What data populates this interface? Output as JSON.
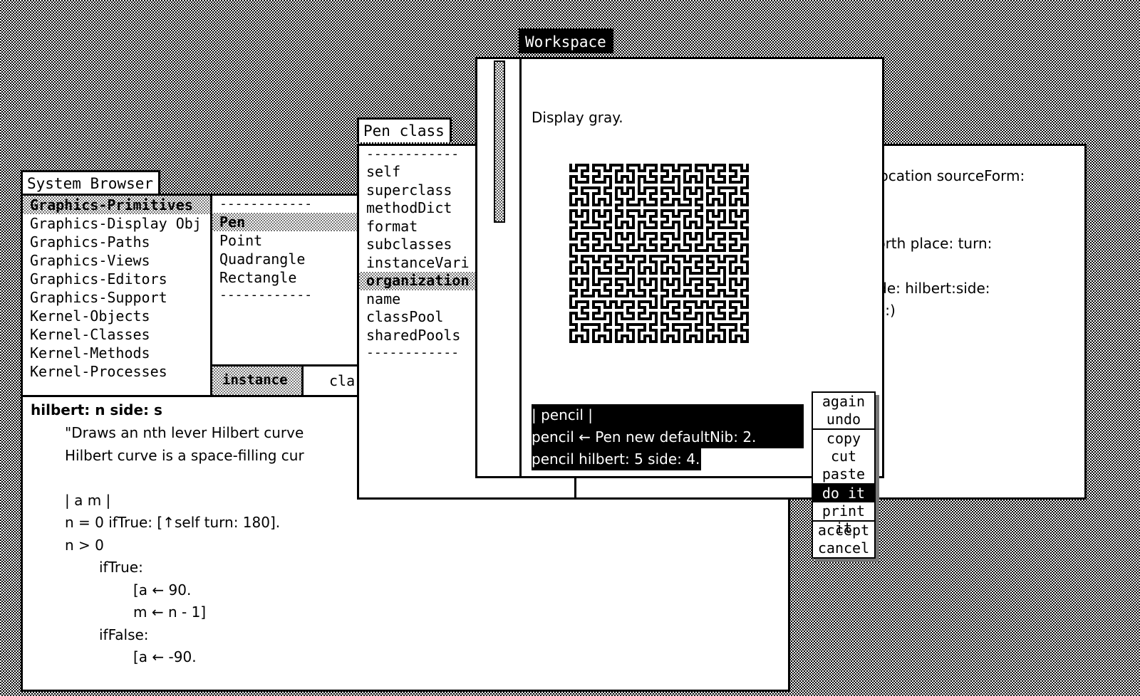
{
  "browser": {
    "title": "System Browser",
    "categories": [
      "Graphics-Primitives",
      "Graphics-Display Obj",
      "Graphics-Paths",
      "Graphics-Views",
      "Graphics-Editors",
      "Graphics-Support",
      "Kernel-Objects",
      "Kernel-Classes",
      "Kernel-Methods",
      "Kernel-Processes"
    ],
    "selected_category": 0,
    "class_separator": "------------",
    "classes": [
      "Pen",
      "Point",
      "Quadrangle",
      "Rectangle"
    ],
    "selected_class": 0,
    "instance_label": "instance",
    "class_label": "cla",
    "code": {
      "signature": "hilbert: n side: s",
      "lines": [
        "\"Draws an nth lever Hilbert curve",
        "Hilbert curve is a space-filling cur",
        "",
        "| a m |",
        "n = 0 ifTrue: [↑self turn: 180].",
        "n > 0",
        "ifTrue:",
        "[a ← 90.",
        "m ← n - 1]",
        "ifFalse:",
        "[a ← -90."
      ]
    }
  },
  "inspector": {
    "title": "Pen class",
    "separator": "------------",
    "fields": [
      "self",
      "superclass",
      "methodDict",
      "format",
      "subclasses",
      "instanceVari",
      "organization",
      "name",
      "classPool",
      "sharedPools"
    ],
    "selected_field": 6
  },
  "right_window": {
    "lines": [
      "location sourceForm:",
      "",
      "",
      "e north place: turn:",
      "",
      "s:side: hilbert:side:",
      "ngle:)"
    ]
  },
  "workspace": {
    "title": "Workspace",
    "text": "Display gray.",
    "selected_code": [
      "| pencil |",
      "pencil ← Pen new defaultNib: 2.",
      "pencil hilbert: 5 side: 4."
    ]
  },
  "context_menu": {
    "groups": [
      [
        "again",
        "undo"
      ],
      [
        "copy",
        "cut",
        "paste"
      ],
      [
        "do it",
        "print it"
      ],
      [
        "accept",
        "cancel"
      ]
    ],
    "selected": "do it"
  }
}
